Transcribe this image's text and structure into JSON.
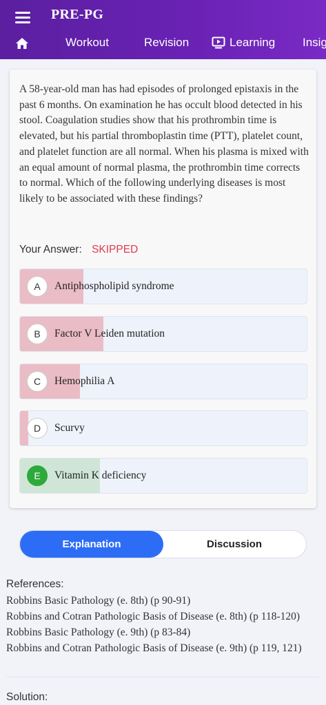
{
  "header": {
    "title": "PRE-PG",
    "background": "#6a22b5"
  },
  "nav": {
    "tabs": [
      {
        "label": "Workout",
        "icon": "none"
      },
      {
        "label": "Revision",
        "icon": "none"
      },
      {
        "label": "Learning",
        "icon": "tv-play-icon"
      },
      {
        "label": "Insig",
        "icon": "none"
      }
    ]
  },
  "question": {
    "text": "A 58-year-old man has had episodes of prolonged epistaxis in the past 6 months. On examination he has occult blood detected in his stool. Coagulation studies show that his prothrombin time is elevated, but his partial thromboplastin time (PTT), platelet count, and platelet function are all normal. When his plasma is mixed with an equal amount of normal plasma, the prothrombin time corrects to normal. Which of the following underlying diseases is most likely to be associated with these findings?",
    "your_answer_label": "Your Answer:",
    "your_answer_status": "SKIPPED",
    "options": [
      {
        "letter": "A",
        "text": "Antiphospholipid syndrome",
        "response_fraction": 0.22,
        "bar_color": "#eabcc6",
        "correct": false
      },
      {
        "letter": "B",
        "text": "Factor V Leiden mutation",
        "response_fraction": 0.29,
        "bar_color": "#eabcc6",
        "correct": false
      },
      {
        "letter": "C",
        "text": "Hemophilia A",
        "response_fraction": 0.21,
        "bar_color": "#eabcc6",
        "correct": false
      },
      {
        "letter": "D",
        "text": "Scurvy",
        "response_fraction": 0.03,
        "bar_color": "#eabcc6",
        "correct": false
      },
      {
        "letter": "E",
        "text": "Vitamin K deficiency",
        "response_fraction": 0.28,
        "bar_color": "#cfe6d6",
        "correct": true
      }
    ]
  },
  "toggle": {
    "explanation_label": "Explanation",
    "discussion_label": "Discussion",
    "active": "Explanation",
    "active_color": "#2d6df6"
  },
  "references": {
    "heading": "References:",
    "items": [
      "Robbins Basic Pathology (e. 8th) (p 90-91)",
      "Robbins and Cotran Pathologic Basis of Disease (e. 8th) (p 118-120)",
      "Robbins Basic Pathology (e. 9th) (p 83-84)",
      "Robbins and Cotran Pathologic Basis of Disease (e. 9th) (p 119, 121)"
    ]
  },
  "solution": {
    "heading": "Solution:"
  }
}
